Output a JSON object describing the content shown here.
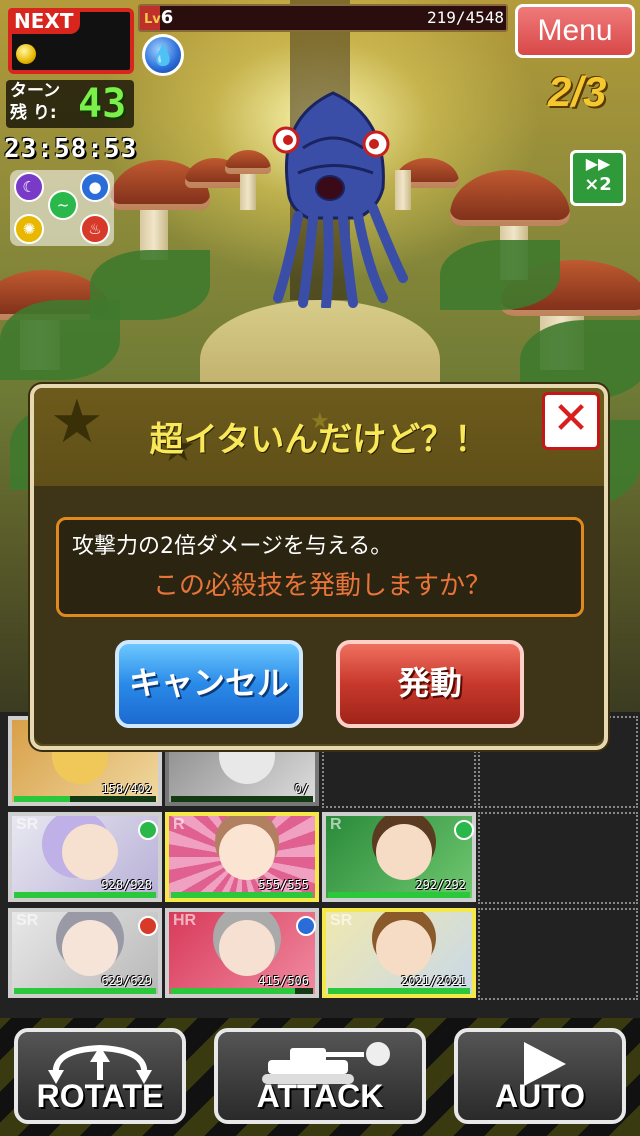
{
  "hud": {
    "next_label": "NEXT",
    "level_prefix": "Lv",
    "level": "6",
    "exp": "219/4548",
    "menu_label": "Menu",
    "wave": "2/3",
    "turns_label": "ターン\n残 り:",
    "turns_value": "43",
    "timer": "23:58:53",
    "speed_label": "×2"
  },
  "dialog": {
    "title": "超イタいんだけど？！",
    "description": "攻撃力の2倍ダメージを与える。",
    "confirm": "この必殺技を発動しますか？",
    "cancel_label": "キャンセル",
    "activate_label": "発動"
  },
  "cards": [
    {
      "rarity": "",
      "hp": "158/402",
      "hp_fraction": 0.39
    },
    {
      "rarity": "",
      "hp": "0/",
      "hp_fraction": 0
    },
    {
      "rarity": "SR",
      "hp": "928/928",
      "hp_fraction": 1.0
    },
    {
      "rarity": "R",
      "hp": "555/555",
      "hp_fraction": 1.0
    },
    {
      "rarity": "R",
      "hp": "292/292",
      "hp_fraction": 1.0
    },
    {
      "rarity": "SR",
      "hp": "629/629",
      "hp_fraction": 1.0
    },
    {
      "rarity": "HR",
      "hp": "415/506",
      "hp_fraction": 0.82
    },
    {
      "rarity": "SR",
      "hp": "2021/2021",
      "hp_fraction": 1.0
    }
  ],
  "bottom": {
    "rotate_label": "ROTATE",
    "attack_label": "ATTACK",
    "auto_label": "AUTO"
  },
  "colors": {
    "next_red": "#d8261f",
    "turns_green": "#7cf04a",
    "wave_gold": "#f6c830",
    "dialog_title": "#f8e85a",
    "confirm_orange": "#e8743a",
    "cancel_blue": "#2a8ae8",
    "activate_red": "#c8382c",
    "menu_pink": "#e05a5a"
  },
  "icons": {
    "element_water": "water-drop-icon",
    "element_fire": "fire-icon",
    "element_wind": "wind-icon",
    "element_light": "light-icon",
    "element_dark": "dark-moon-icon"
  }
}
